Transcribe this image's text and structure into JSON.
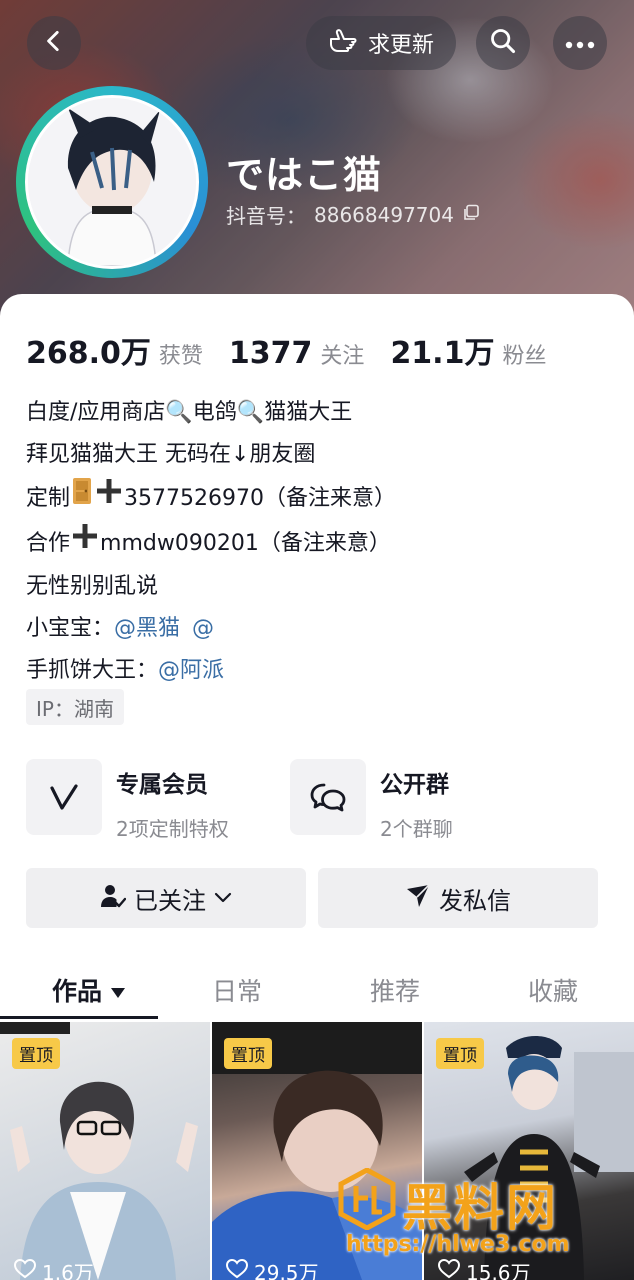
{
  "header": {
    "update_label": "求更新",
    "nickname": "ではこ猫",
    "uid_label": "抖音号：",
    "uid_value": "88668497704"
  },
  "stats": [
    {
      "num": "268.0万",
      "label": "获赞"
    },
    {
      "num": "1377",
      "label": "关注"
    },
    {
      "num": "21.1万",
      "label": "粉丝"
    }
  ],
  "bio": {
    "line1": "白度/应用商店🔍电鸽🔍猫猫大王",
    "line2": "拜见猫猫大王 无码在↓朋友圈",
    "line3_prefix": "定制",
    "line3_suffix": "3577526970（备注来意）",
    "line4_prefix": "合作",
    "line4_suffix": "mmdw090201（备注来意）",
    "line5": "无性别别乱说",
    "line6_prefix": "小宝宝：",
    "line6_mention1": "@黑猫",
    "line6_mention2": "@",
    "line7_prefix": "手抓饼大王：",
    "line7_mention": "@阿派"
  },
  "ip_tag": "IP：湖南",
  "features": {
    "member_title": "专属会员",
    "member_sub": "2项定制特权",
    "group_title": "公开群",
    "group_sub": "2个群聊"
  },
  "actions": {
    "follow_label": "已关注",
    "message_label": "发私信"
  },
  "tabs": [
    "作品",
    "日常",
    "推荐",
    "收藏"
  ],
  "videos": [
    {
      "pin": "置顶",
      "likes": "1.6万"
    },
    {
      "pin": "置顶",
      "likes": "29.5万"
    },
    {
      "pin": "置顶",
      "likes": "15.6万"
    }
  ],
  "watermark": {
    "brand": "黑料网",
    "url": "https://hlwe3.com"
  },
  "colors": {
    "accent_mention": "#3a6ea5",
    "pin_badge": "#f7c948",
    "avatar_ring": "#2bb7c9"
  }
}
